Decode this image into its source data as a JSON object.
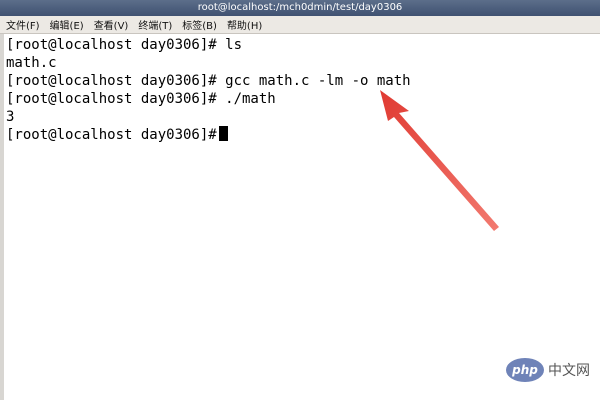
{
  "window": {
    "title": "root@localhost:/mch0dmin/test/day0306"
  },
  "menu": {
    "items": [
      {
        "label": "文件(F)"
      },
      {
        "label": "编辑(E)"
      },
      {
        "label": "查看(V)"
      },
      {
        "label": "终端(T)"
      },
      {
        "label": "标签(B)"
      },
      {
        "label": "帮助(H)"
      }
    ]
  },
  "terminal": {
    "lines": [
      "[root@localhost day0306]# ls",
      "math.c",
      "[root@localhost day0306]# gcc math.c -lm -o math",
      "[root@localhost day0306]# ./math",
      "3"
    ],
    "prompt": "[root@localhost day0306]#"
  },
  "annotation": {
    "arrow_color": "#e03a32"
  },
  "watermark": {
    "logo_text": "php",
    "text": "中文网"
  }
}
